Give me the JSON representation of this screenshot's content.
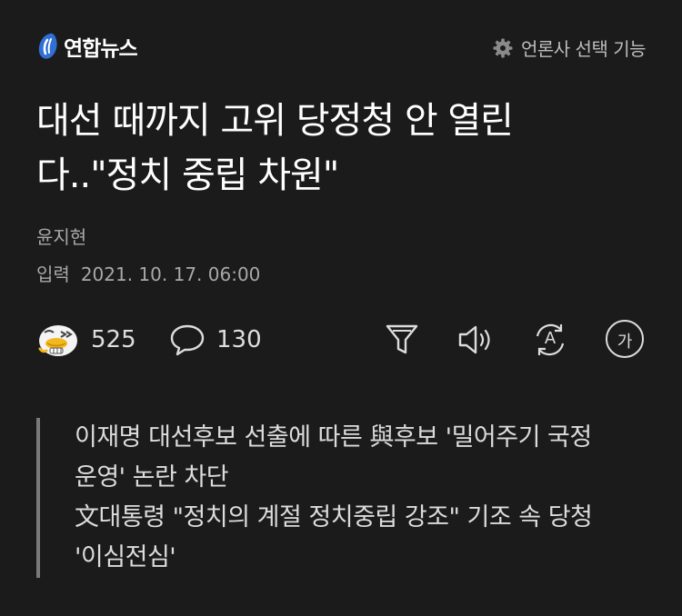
{
  "header": {
    "logo_text": "연합뉴스",
    "press_select_label": "언론사 선택 기능"
  },
  "article": {
    "title_line1": "대선 때까지 고위 당정청 안 열린",
    "title_line2": "다..\"정치 중립 차원\"",
    "reporter": "윤지현",
    "date_label": "입력",
    "date_value": "2021. 10. 17. 06:00"
  },
  "toolbar": {
    "reaction_count": "525",
    "comment_count": "130",
    "font_icon_glyph": "가",
    "translate_icon_glyph": "A"
  },
  "summary": [
    "이재명 대선후보 선출에 따른 與후보 '밀어주기 국정",
    "운영' 논란 차단",
    "文대통령 \"정치의 계절 정치중립 강조\" 기조 속 당청",
    "'이심전심'"
  ]
}
